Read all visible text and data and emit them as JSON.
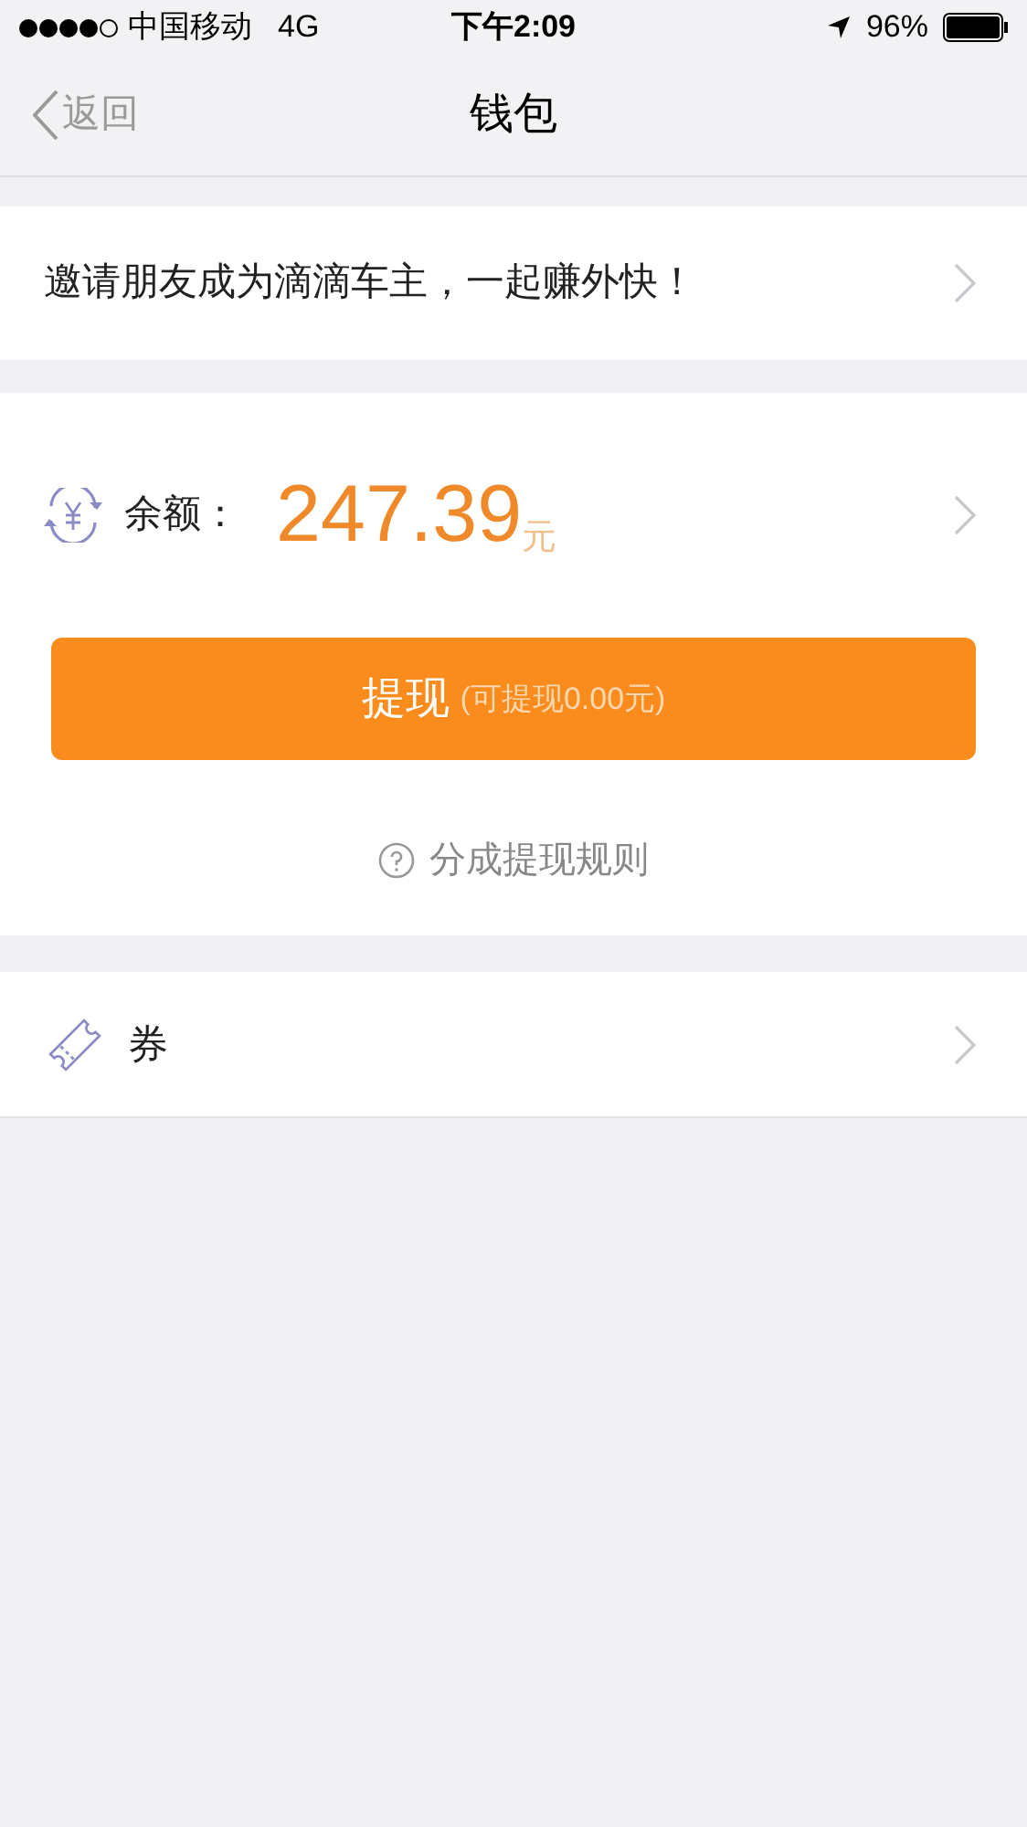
{
  "status_bar": {
    "carrier": "中国移动",
    "network": "4G",
    "time": "下午2:09",
    "battery": "96%"
  },
  "nav": {
    "back": "返回",
    "title": "钱包"
  },
  "invite_row": {
    "text": "邀请朋友成为滴滴车主，一起赚外快！"
  },
  "balance": {
    "label": "余额：",
    "amount": "247.39",
    "unit": "元"
  },
  "withdraw_button": {
    "label": "提现",
    "note": "(可提现0.00元)"
  },
  "rules_link": {
    "text": "分成提现规则"
  },
  "coupon_row": {
    "label": "券"
  }
}
